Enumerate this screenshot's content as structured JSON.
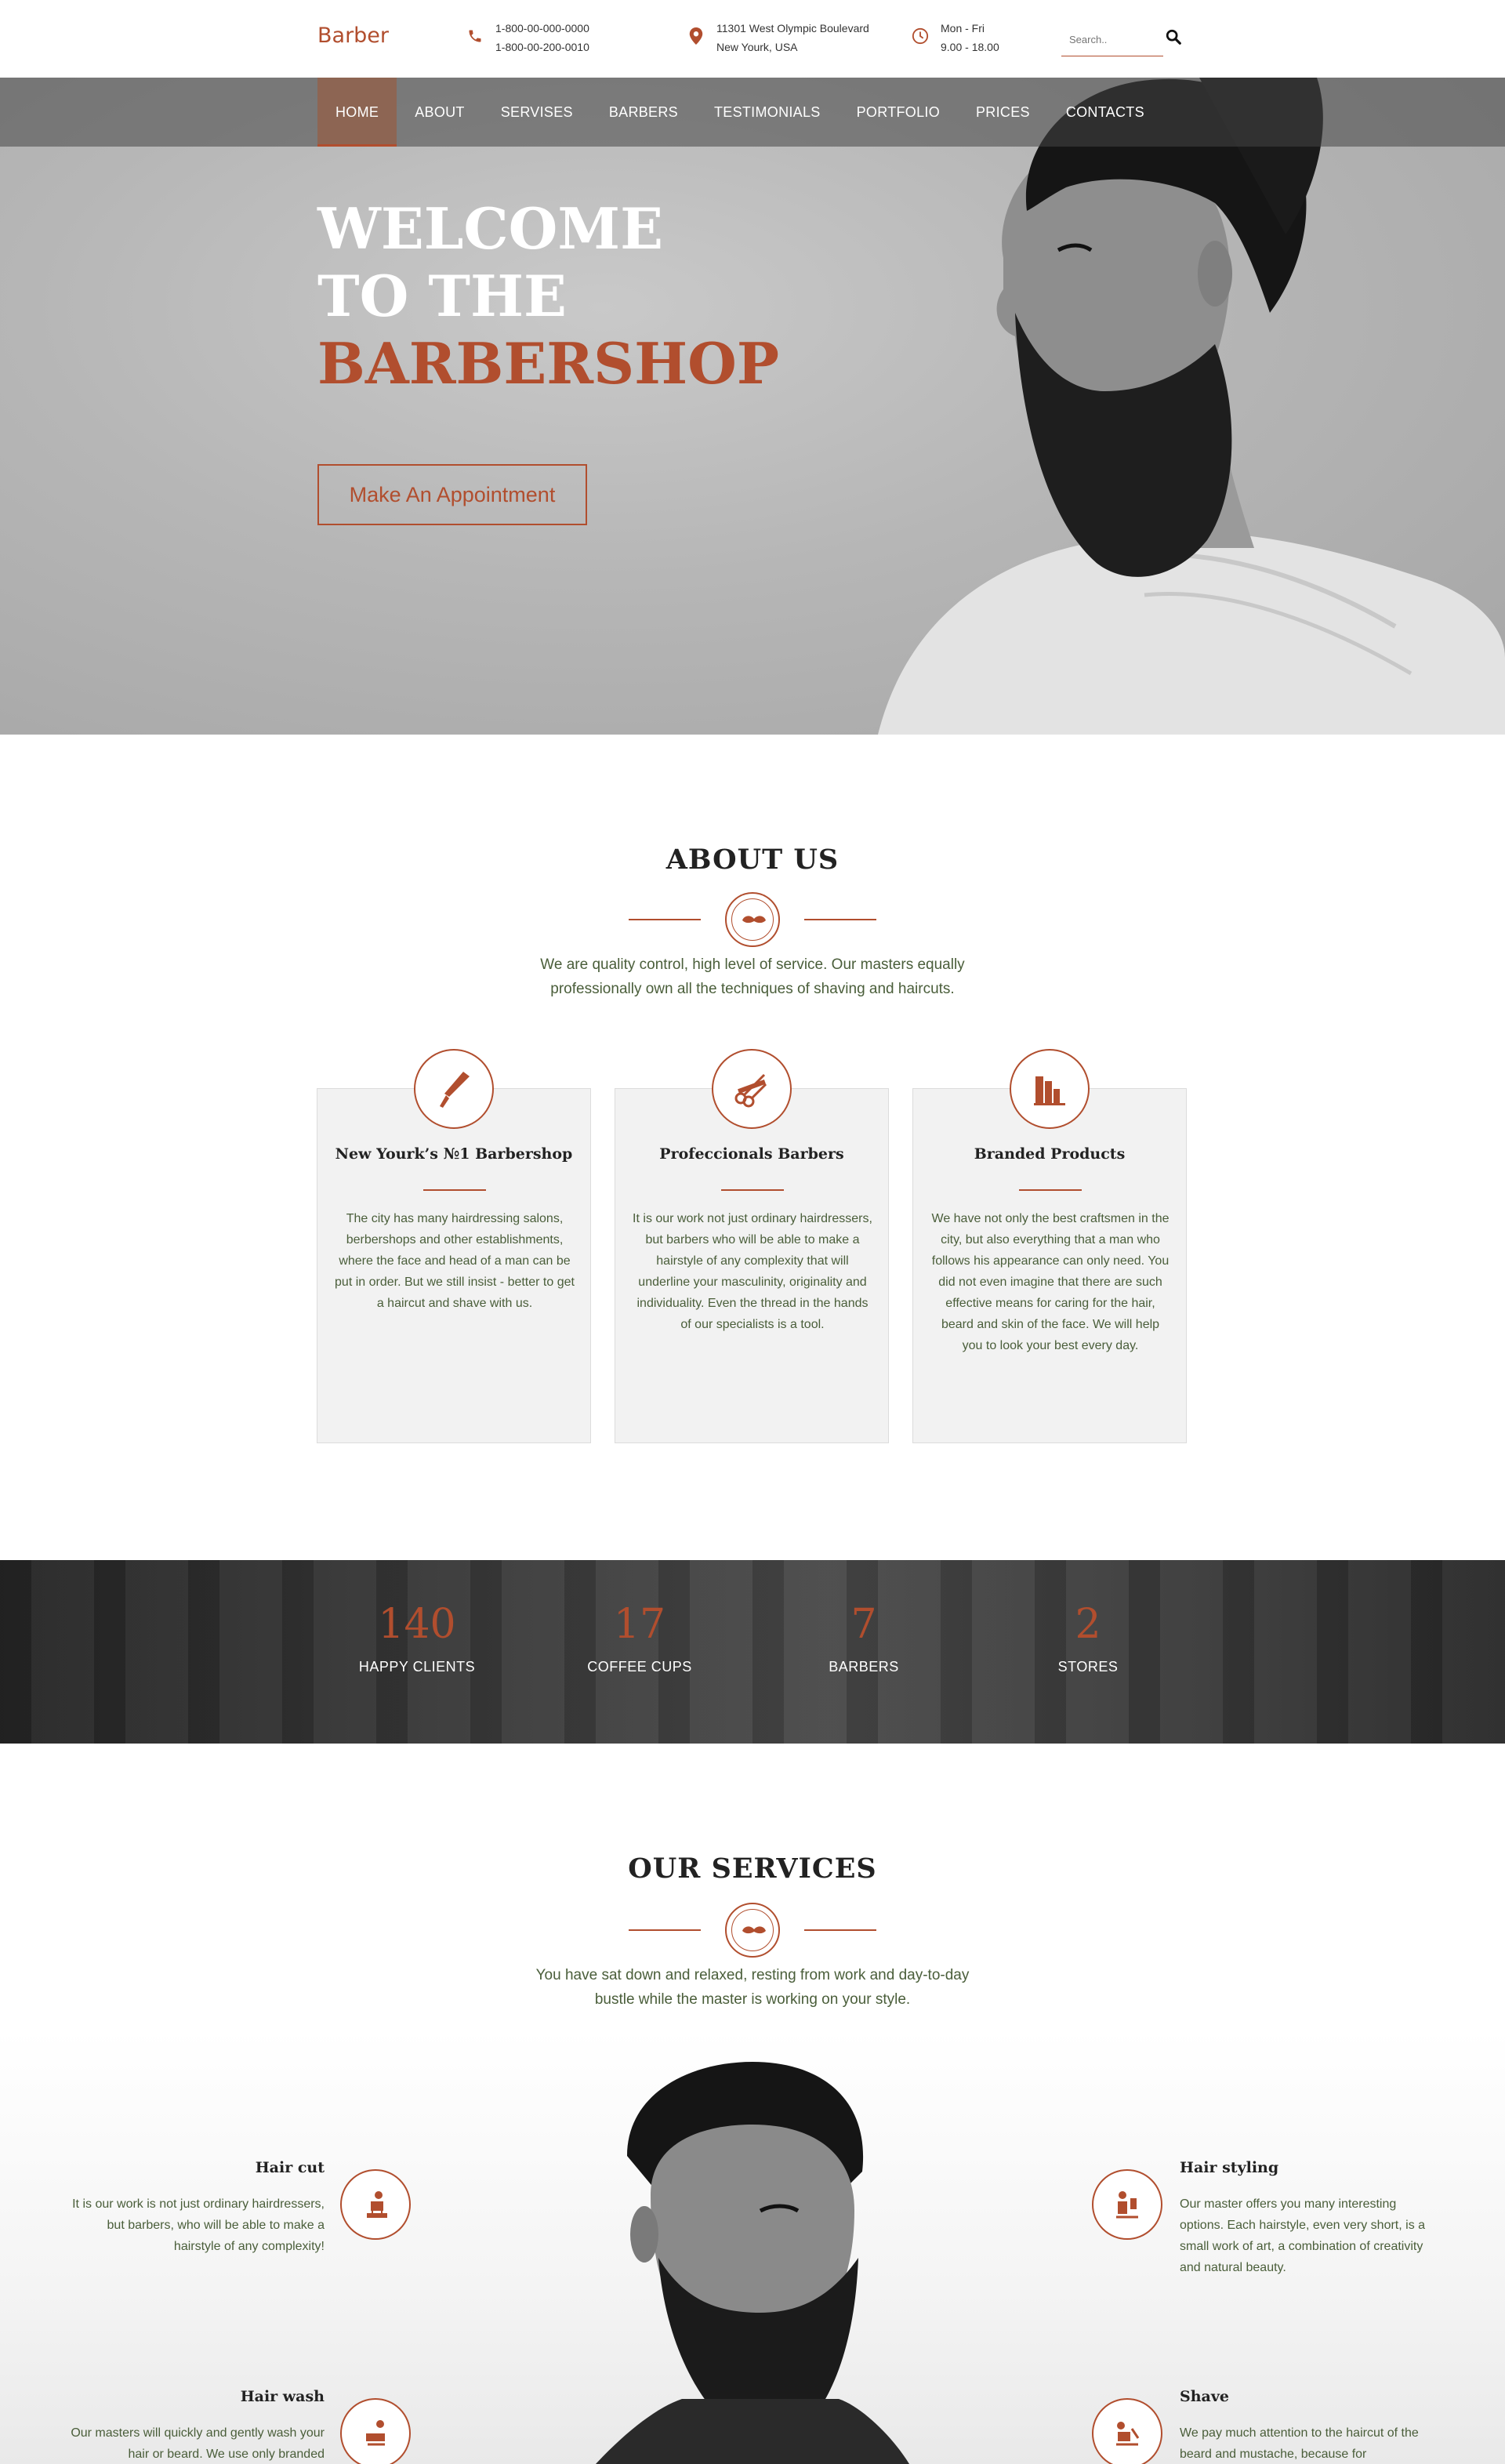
{
  "header": {
    "brand": "Barber",
    "phone1": "1-800-00-000-0000",
    "phone2": "1-800-00-200-0010",
    "address1": "11301 West Olympic Boulevard",
    "address2": "New Yourk, USA",
    "hours1": "Mon - Fri",
    "hours2": "9.00 - 18.00",
    "search_placeholder": "Search..",
    "icons": [
      "phone-icon",
      "map-pin-icon",
      "clock-icon",
      "search-icon"
    ]
  },
  "nav": {
    "items": [
      "HOME",
      "ABOUT",
      "SERVISES",
      "BARBERS",
      "TESTIMONIALS",
      "PORTFOLIO",
      "PRICES",
      "CONTACTS"
    ],
    "active": "HOME"
  },
  "hero": {
    "line1": "WELCOME",
    "line2": "TO THE",
    "line3": "BARBERSHOP",
    "button": "Make An Appointment"
  },
  "about": {
    "title": "ABOUT US",
    "lead": "We are quality control, high level of service. Our masters equally professionally own all the techniques of shaving and haircuts.",
    "cards": [
      {
        "title": "New Yourk’s №1 Barbershop",
        "text": "The city has many hairdressing salons, berbershops and other establishments, where the face and head of a man can be put in order. But we still insist - better to get a haircut and shave with us.",
        "icon": "razor-icon"
      },
      {
        "title": "Profeccionals Barbers",
        "text": "It is our work not just ordinary hairdressers, but barbers who will be able to make a hairstyle of any complexity that will underline your masculinity, originality and individuality. Even the thread in the hands of our specialists is a tool.",
        "icon": "scissors-comb-icon"
      },
      {
        "title": "Branded Products",
        "text": "We have not only the best craftsmen in the city, but also everything that a man who follows his appearance can only need. You did not even imagine that there are such effective means for caring for the hair, beard and skin of the face. We will help you to look your best every day.",
        "icon": "products-bottles-icon"
      }
    ]
  },
  "counters": [
    {
      "num": "140",
      "label": "HAPPY CLIENTS"
    },
    {
      "num": "17",
      "label": "COFFEE CUPS"
    },
    {
      "num": "7",
      "label": "BARBERS"
    },
    {
      "num": "2",
      "label": "STORES"
    }
  ],
  "services": {
    "title": "OUR SERVICES",
    "lead": "You have sat down and relaxed, resting from work and day-to-day bustle while the master is working on your style.",
    "items": [
      {
        "title": "Hair cut",
        "text": "It is our work is not just ordinary hairdressers, but barbers, who will be able to make a hairstyle of any complexity!",
        "icon": "haircut-chair-icon"
      },
      {
        "title": "Hair styling",
        "text": "Our master offers you many interesting options. Each hairstyle, even very short, is a small work of art, a combination of creativity and natural beauty.",
        "icon": "styling-icon"
      },
      {
        "title": "Hair wash",
        "text": "Our masters will quickly and gently wash your hair or beard. We use only branded",
        "icon": "hair-wash-icon"
      },
      {
        "title": "Shave",
        "text": "We pay much attention to the haircut of the beard and mustache, because for",
        "icon": "shave-icon"
      }
    ]
  },
  "colors": {
    "accent": "#b14e2e",
    "text": "#4a5e3a",
    "dark": "#222222"
  }
}
